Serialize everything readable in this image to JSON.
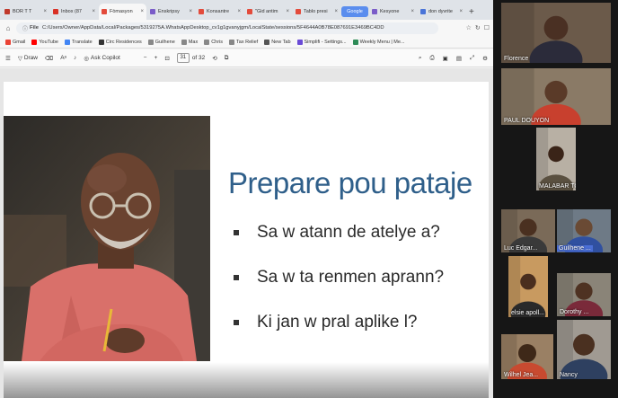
{
  "browser": {
    "tabs": [
      {
        "label": "BOR T T",
        "color": "#c0392b"
      },
      {
        "label": "Inbox (87",
        "color": "#d93025"
      },
      {
        "label": "Fòmasyon",
        "color": "#e34b3b",
        "active": true
      },
      {
        "label": "Enskripsy",
        "color": "#7a5cc8"
      },
      {
        "label": "Konsantre",
        "color": "#e34b3b"
      },
      {
        "label": "\"Gid antim",
        "color": "#e34b3b"
      },
      {
        "label": "Tablo presi",
        "color": "#e34b3b"
      },
      {
        "label": "Google",
        "google": true
      },
      {
        "label": "Kesyone",
        "color": "#7a5cc8"
      },
      {
        "label": "don dyvrite",
        "color": "#4a74d8"
      }
    ],
    "new_tab": "+",
    "address": {
      "scheme": "File",
      "url": "C:/Users/Owner/AppData/Local/Packages/5319275A.WhatsAppDesktop_cv1g1gvanyjgm/LocalState/sessions/5F4644A0B78E087691E3469BC4DD"
    },
    "bookmarks": [
      {
        "label": "Gmail",
        "color": "#ea4335"
      },
      {
        "label": "YouTube",
        "color": "#ff0000"
      },
      {
        "label": "Translate",
        "color": "#4285f4"
      },
      {
        "label": "Circ Residences",
        "color": "#333333"
      },
      {
        "label": "Guilhene",
        "color": "#888888"
      },
      {
        "label": "Max",
        "color": "#888888"
      },
      {
        "label": "Chris",
        "color": "#888888"
      },
      {
        "label": "Tax Relief",
        "color": "#888888"
      },
      {
        "label": "New Tab",
        "color": "#555555"
      },
      {
        "label": "Simplifi - Settings...",
        "color": "#6a4bd6"
      },
      {
        "label": "Weekly Menu | Me...",
        "color": "#2e8b57"
      }
    ],
    "pdf_toolbar": {
      "draw": "Draw",
      "ask_copilot": "Ask Copilot",
      "minus": "−",
      "plus": "+",
      "page_current": "31",
      "page_total": "of 32"
    }
  },
  "slide": {
    "title": "Prepare pou pataje",
    "bullets": [
      "Sa w atann de atelye a?",
      "Sa w ta renmen aprann?",
      "Ki jan w pral aplike l?"
    ]
  },
  "participants": [
    {
      "name": "Florence",
      "bg": "#6b5a4a",
      "skin": "#4a3023",
      "shirt": "#2b2b3a"
    },
    {
      "name": "PAUL DOUYON",
      "bg": "#8a7a66",
      "skin": "#5a3a28",
      "shirt": "#c8402e"
    },
    {
      "name": "MALABAR TOUSSENDO F...",
      "bg": "#b8b0a4",
      "skin": "#3a2418",
      "shirt": "#5a5040"
    },
    {
      "name": "Luc Edgar...",
      "bg": "#7a6a58",
      "skin": "#4a3020",
      "shirt": "#3a3a3a"
    },
    {
      "name": "Guilhene ...",
      "bg": "#6e7a86",
      "skin": "#6a4a34",
      "shirt": "#3050a0",
      "highlight": true
    },
    {
      "name": "elsie apoll...",
      "bg": "#c89a60",
      "skin": "#4a2e1e",
      "shirt": "#2a2a2a"
    },
    {
      "name": "Dorothy ...",
      "bg": "#8a8478",
      "skin": "#4e3222",
      "shirt": "#7a2a3a"
    },
    {
      "name": "Wilhel Jea...",
      "bg": "#9a8064",
      "skin": "#3e2818",
      "shirt": "#c84a30"
    },
    {
      "name": "Nancy",
      "bg": "#a09a92",
      "skin": "#4a3020",
      "shirt": "#2e4060"
    }
  ]
}
